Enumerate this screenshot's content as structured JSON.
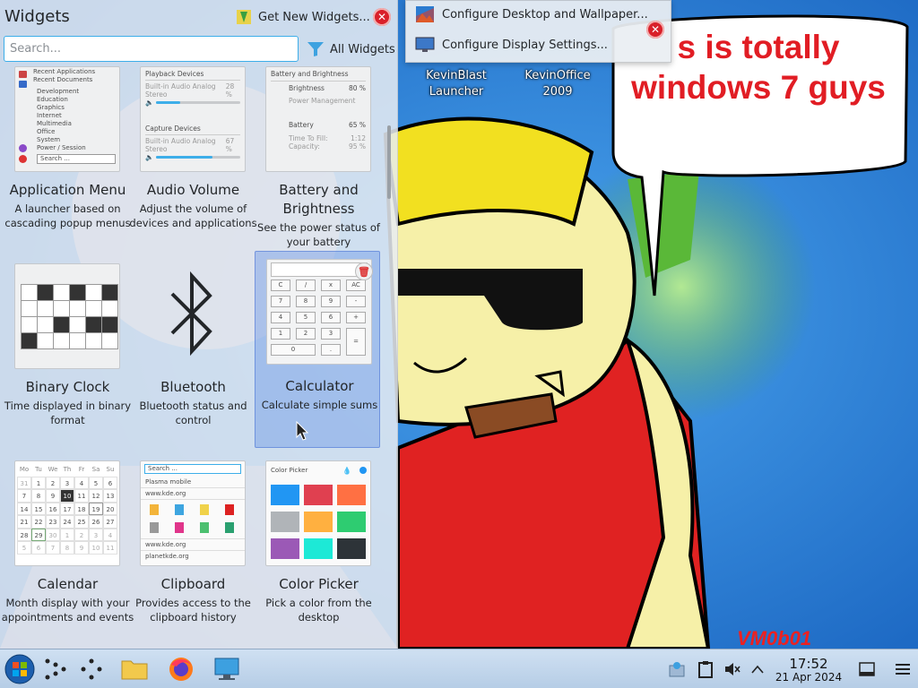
{
  "panel": {
    "title": "Widgets",
    "get_new_label": "Get New Widgets...",
    "search_placeholder": "Search...",
    "all_widgets_label": "All Widgets"
  },
  "widgets": [
    {
      "name": "Application Menu",
      "desc": "A launcher based on cascading popup menus"
    },
    {
      "name": "Audio Volume",
      "desc": "Adjust the volume of devices and applications"
    },
    {
      "name": "Battery and Brightness",
      "desc": "See the power status of your battery"
    },
    {
      "name": "Binary Clock",
      "desc": "Time displayed in binary format"
    },
    {
      "name": "Bluetooth",
      "desc": "Bluetooth status and control"
    },
    {
      "name": "Calculator",
      "desc": "Calculate simple sums"
    },
    {
      "name": "Calendar",
      "desc": "Month display with your appointments and events"
    },
    {
      "name": "Clipboard",
      "desc": "Provides access to the clipboard history"
    },
    {
      "name": "Color Picker",
      "desc": "Pick a color from the desktop"
    }
  ],
  "thumbs": {
    "appmenu": [
      "Recent Applications",
      "Recent Documents",
      "Development",
      "Education",
      "Graphics",
      "Internet",
      "Multimedia",
      "Office",
      "System",
      "Power / Session",
      "Search ..."
    ],
    "audio": {
      "playback": "Playback Devices",
      "playback_dev": "Built-in Audio Analog Stereo",
      "playback_pct": "28 %",
      "playback_level": 0.28,
      "capture": "Capture Devices",
      "capture_dev": "Built-in Audio Analog Stereo",
      "capture_pct": "67 %",
      "capture_level": 0.67
    },
    "battery": {
      "title": "Battery and Brightness",
      "brightness": "Brightness",
      "brightness_pct": "80 %",
      "power_mgmt": "Power Management",
      "battery": "Battery",
      "battery_pct": "65 %",
      "time_to_fill": "Time To Fill:",
      "time_val": "1:12",
      "capacity": "Capacity:",
      "capacity_val": "95 %"
    },
    "calculator_keys": [
      "C",
      "/",
      "x",
      "AC",
      "7",
      "8",
      "9",
      "-",
      "4",
      "5",
      "6",
      "+",
      "1",
      "2",
      "3",
      "=",
      "0",
      "."
    ],
    "calendar_head": [
      "Mo",
      "Tu",
      "We",
      "Th",
      "Fr",
      "Sa",
      "Su"
    ],
    "calendar_days": [
      "31",
      "1",
      "2",
      "3",
      "4",
      "5",
      "6",
      "7",
      "8",
      "9",
      "10",
      "11",
      "12",
      "13",
      "14",
      "15",
      "16",
      "17",
      "18",
      "19",
      "20",
      "21",
      "22",
      "23",
      "24",
      "25",
      "26",
      "27",
      "28",
      "29",
      "30",
      "1",
      "2",
      "3",
      "4",
      "5",
      "6",
      "7",
      "8",
      "9",
      "10",
      "11"
    ],
    "clipboard": {
      "search": "Search ...",
      "item1": "Plasma mobile",
      "item2": "www.kde.org",
      "item3": "www.kde.org",
      "item4": "planetkde.org"
    },
    "colorpicker": {
      "title": "Color Picker",
      "swatches": [
        "#2196f3",
        "#e04050",
        "#ff7043",
        "#b0b4b8",
        "#ffb040",
        "#2ecc71",
        "#9b59b6",
        "#1de9d6",
        "#2d3338"
      ]
    }
  },
  "context_menu": {
    "item1": "Configure Desktop and Wallpaper...",
    "item2": "Configure Display Settings..."
  },
  "desktop": {
    "icon1": "KevinBlast Launcher",
    "icon2": "KevinOffice 2009",
    "bubble": "s is totally windows 7 guys",
    "signature": "VM0b01"
  },
  "taskbar": {
    "time": "17:52",
    "date": "21 Apr 2024"
  },
  "colors": {
    "accent": "#3daee9",
    "selection": "#5a8ce6",
    "close_red": "#d9202a"
  }
}
